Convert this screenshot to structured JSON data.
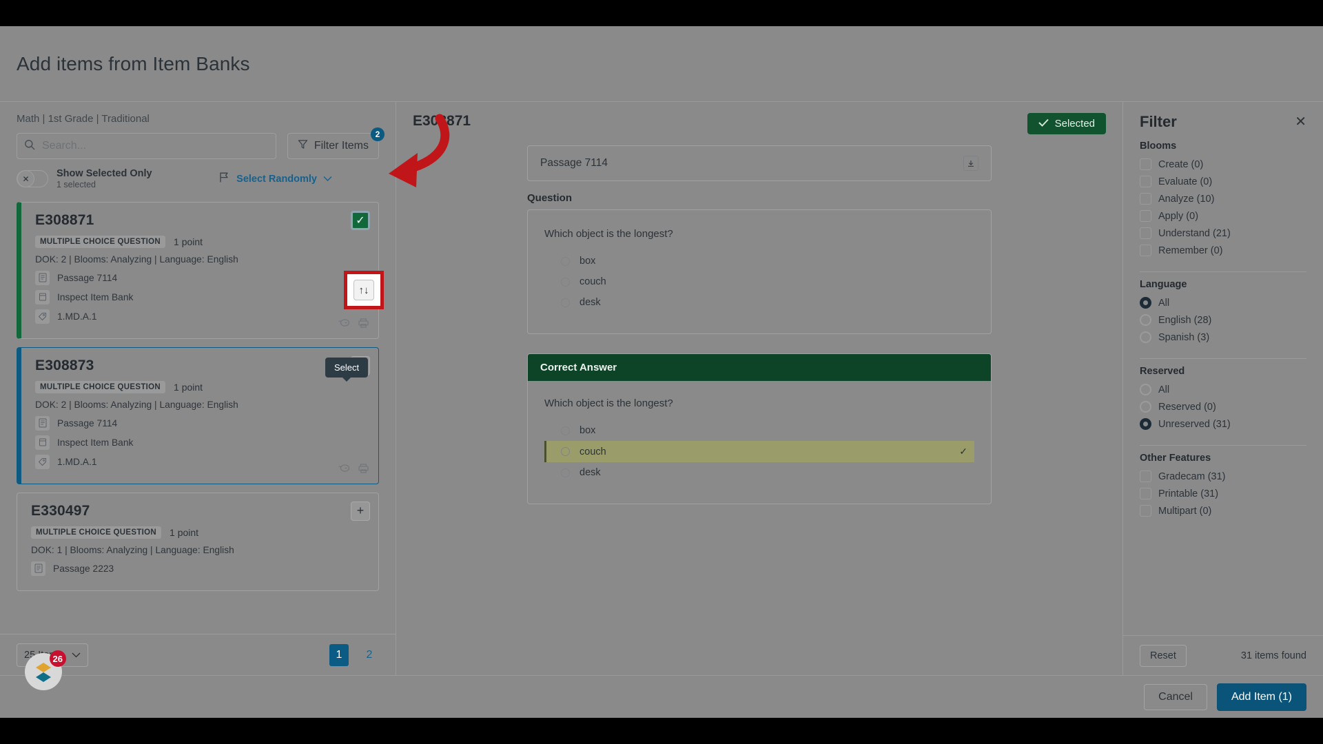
{
  "header": {
    "title": "Add items from Item Banks"
  },
  "left": {
    "breadcrumb": "Math | 1st Grade | Traditional",
    "search": {
      "placeholder": "Search...",
      "value": "",
      "icon": "search-icon"
    },
    "filter_button": {
      "label": "Filter Items",
      "badge": "2",
      "icon": "funnel-icon"
    },
    "toggle": {
      "title": "Show Selected Only",
      "subtitle": "1 selected",
      "state": "off",
      "knob_glyph": "✕"
    },
    "select_randomly": {
      "label": "Select Randomly",
      "icon": "flag-icon",
      "chevron": "chevron-down-icon"
    },
    "sort_button": {
      "icon": "sort-arrows-icon",
      "glyph": "↑↓"
    },
    "tooltip": {
      "label": "Select"
    },
    "cards": [
      {
        "id": "E308871",
        "type": "MULTIPLE CHOICE QUESTION",
        "points": "1 point",
        "meta": "DOK: 2  |  Blooms: Analyzing  |  Language: English",
        "passage": "Passage 7114",
        "bank": "Inspect Item Bank",
        "standard": "1.MD.A.1",
        "state": "selected",
        "action_glyph": "✓"
      },
      {
        "id": "E308873",
        "type": "MULTIPLE CHOICE QUESTION",
        "points": "1 point",
        "meta": "DOK: 2  |  Blooms: Analyzing  |  Language: English",
        "passage": "Passage 7114",
        "bank": "Inspect Item Bank",
        "standard": "1.MD.A.1",
        "state": "active",
        "action_glyph": "+"
      },
      {
        "id": "E330497",
        "type": "MULTIPLE CHOICE QUESTION",
        "points": "1 point",
        "meta": "DOK: 1  |  Blooms: Analyzing  |  Language: English",
        "passage": "Passage 2223",
        "bank": "",
        "standard": "",
        "state": "normal",
        "action_glyph": "+"
      }
    ],
    "footer": {
      "page_size": "25 Items",
      "pages": [
        {
          "label": "1",
          "current": true
        },
        {
          "label": "2",
          "current": false
        }
      ]
    }
  },
  "center": {
    "preview_id": "E308871",
    "selected_pill": {
      "label": "Selected",
      "icon": "check-icon"
    },
    "passage": {
      "value": "Passage 7114",
      "expand_icon": "expand-down-icon"
    },
    "question_label": "Question",
    "question": {
      "text": "Which object is the longest?",
      "choices": [
        "box",
        "couch",
        "desk"
      ]
    },
    "answer": {
      "header": "Correct Answer",
      "text": "Which object is the longest?",
      "choices": [
        {
          "label": "box",
          "correct": false
        },
        {
          "label": "couch",
          "correct": true
        },
        {
          "label": "desk",
          "correct": false
        }
      ],
      "check_glyph": "✓"
    }
  },
  "right": {
    "title": "Filter",
    "close_glyph": "✕",
    "groups": [
      {
        "name": "Blooms",
        "control": "checkbox",
        "options": [
          {
            "label": "Create (0)",
            "checked": false
          },
          {
            "label": "Evaluate (0)",
            "checked": false
          },
          {
            "label": "Analyze (10)",
            "checked": false
          },
          {
            "label": "Apply (0)",
            "checked": false
          },
          {
            "label": "Understand (21)",
            "checked": false
          },
          {
            "label": "Remember (0)",
            "checked": false
          }
        ]
      },
      {
        "name": "Language",
        "control": "radio",
        "options": [
          {
            "label": "All",
            "checked": true
          },
          {
            "label": "English (28)",
            "checked": false
          },
          {
            "label": "Spanish (3)",
            "checked": false
          }
        ]
      },
      {
        "name": "Reserved",
        "control": "radio",
        "options": [
          {
            "label": "All",
            "checked": false
          },
          {
            "label": "Reserved (0)",
            "checked": false
          },
          {
            "label": "Unreserved (31)",
            "checked": true
          }
        ]
      },
      {
        "name": "Other Features",
        "control": "checkbox",
        "options": [
          {
            "label": "Gradecam (31)",
            "checked": false
          },
          {
            "label": "Printable (31)",
            "checked": false
          },
          {
            "label": "Multipart (0)",
            "checked": false
          }
        ]
      }
    ],
    "reset_label": "Reset",
    "items_found": "31 items found"
  },
  "footer": {
    "cancel_label": "Cancel",
    "add_label": "Add Item (1)"
  },
  "helper_widget": {
    "badge": "26"
  },
  "colors": {
    "selected_accent": "#11683a",
    "active_accent": "#0d5a83",
    "primary_button": "#0b5479",
    "answer_header": "#0d4427",
    "correct_row": "#9a9d6a",
    "annotation_arrow": "#c0161a",
    "link": "#16628f"
  }
}
